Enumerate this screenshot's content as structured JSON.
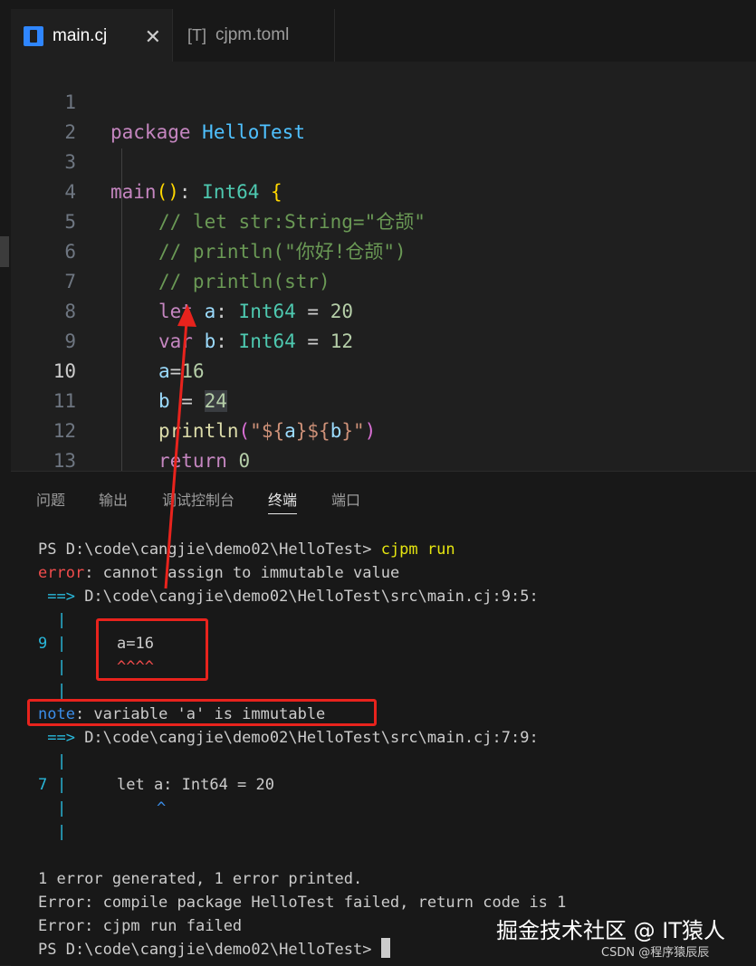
{
  "tabs": [
    {
      "label": "main.cj",
      "close": "✕",
      "icon": "cangjie-file-icon"
    },
    {
      "label": "cjpm.toml",
      "icon_text": "[T]",
      "icon": "toml-file-icon"
    }
  ],
  "editor": {
    "line_numbers": [
      "1",
      "2",
      "3",
      "4",
      "5",
      "6",
      "7",
      "8",
      "9",
      "10",
      "11",
      "12",
      "13"
    ],
    "current_line": "10",
    "lines": {
      "l1": {
        "kw": "package",
        "ns": "HelloTest"
      },
      "l3": {
        "fn": "main",
        "paren": "()",
        "colon": ": ",
        "ty": "Int64",
        "brace": "{"
      },
      "l4": "// let str:String=\"仓颉\"",
      "l5": "// println(\"你好!仓颉\")",
      "l6": "// println(str)",
      "l7": {
        "kw": "let",
        "id": "a",
        "colon": ": ",
        "ty": "Int64",
        "eq": " = ",
        "num": "20"
      },
      "l8": {
        "kw": "var",
        "id": "b",
        "colon": ": ",
        "ty": "Int64",
        "eq": " = ",
        "num": "12"
      },
      "l9": {
        "id": "a",
        "eq": "=",
        "num": "16"
      },
      "l10": {
        "id": "b",
        "eq": " = ",
        "num": "24"
      },
      "l11": {
        "fn": "println",
        "open": "(",
        "str1": "\"${",
        "a": "a",
        "mid": "}${",
        "b": "b",
        "str2": "}\"",
        "close": ")"
      },
      "l12": {
        "kw": "return",
        "num": "0"
      },
      "l13": {
        "brace": "}"
      }
    }
  },
  "panel": {
    "tabs": [
      "问题",
      "输出",
      "调试控制台",
      "终端",
      "端口"
    ],
    "active_tab": "终端",
    "terminal": {
      "l1_prompt": "PS D:\\code\\cangjie\\demo02\\HelloTest> ",
      "l1_cmd": "cjpm run",
      "l2_err": "error",
      "l2_msg": ": cannot assign to immutable value",
      "l3_arrow": " ==>",
      "l3_path": " D:\\code\\cangjie\\demo02\\HelloTest\\src\\main.cj:9:5:",
      "bar": "|",
      "l5_num": "9",
      "l5_code": "a=16",
      "l6_caret": "^^^^",
      "l8_note": "note",
      "l8_msg": ": variable 'a' is immutable",
      "l9_arrow": " ==>",
      "l9_path": " D:\\code\\cangjie\\demo02\\HelloTest\\src\\main.cj:7:9:",
      "l11_num": "7",
      "l11_code": "let a: Int64 = 20",
      "l12_caret": "^",
      "l15": "1 error generated, 1 error printed.",
      "l16": "Error: compile package HelloTest failed, return code is 1",
      "l17": "Error: cjpm run failed",
      "l18_prompt": "PS D:\\code\\cangjie\\demo02\\HelloTest> "
    }
  },
  "watermark": {
    "main": "掘金技术社区 @ IT猿人",
    "sub": "CSDN @程序猿辰辰"
  },
  "colors": {
    "annotation": "#e8231d",
    "background": "#1f1f1f",
    "panel": "#181818"
  }
}
